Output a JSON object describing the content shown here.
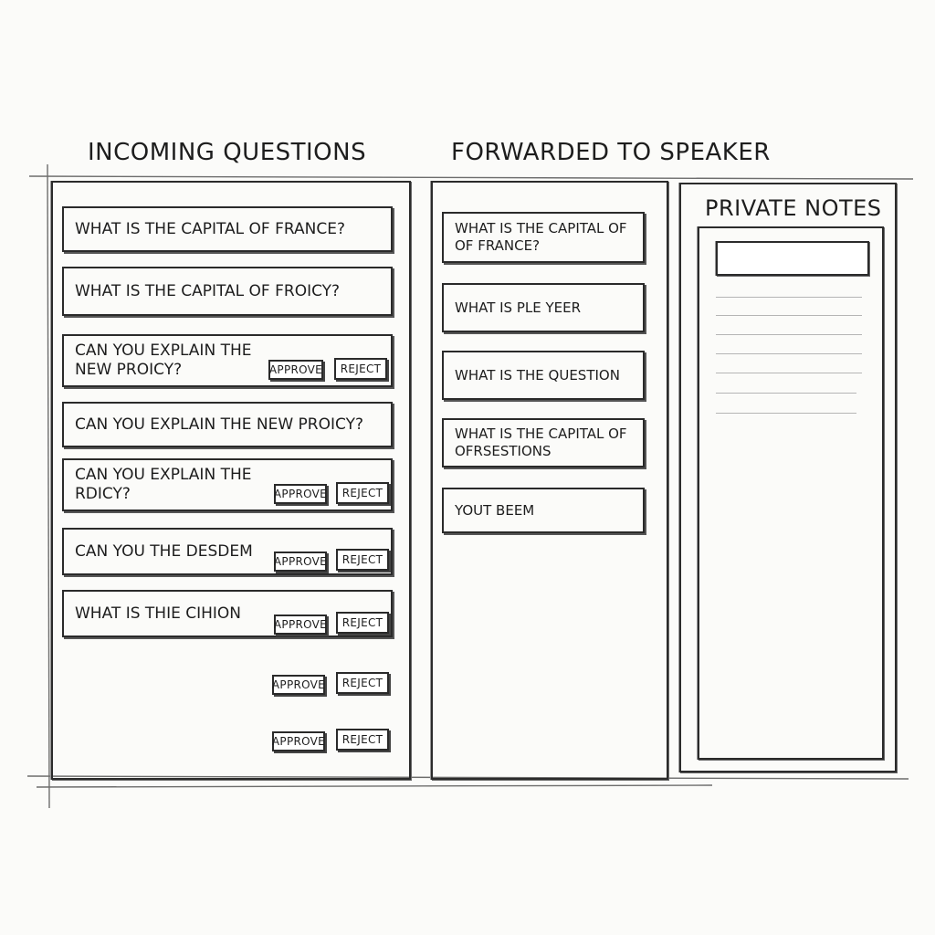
{
  "incoming": {
    "title": "Incoming Questions",
    "questions": [
      {
        "text": "What is the capital of France?"
      },
      {
        "text": "What is the capital of Froicy?"
      },
      {
        "text": "Can you explain the\nnew proicy?",
        "approve": "Approve",
        "reject": "Reject"
      },
      {
        "text": "Can you explain the new proicy?"
      },
      {
        "text": "Can you explain the\nrdicy?",
        "approve": "Approve",
        "reject": "Reject"
      },
      {
        "text": "Can you the desdem",
        "approve": "Approve",
        "reject": "Reject"
      },
      {
        "text": "What is thie cihion",
        "approve": "Approve",
        "reject": "Reject"
      }
    ],
    "extra_actions": [
      {
        "approve": "Approve",
        "reject": "Reject"
      },
      {
        "approve": "Approve",
        "reject": "Reject"
      }
    ]
  },
  "forwarded": {
    "title": "Forwarded to Speaker",
    "items": [
      {
        "text": "What is the capital of\nof France?"
      },
      {
        "text": "What is ple yeer"
      },
      {
        "text": "What is the question"
      },
      {
        "text": "What is the capital of\nofrsestions"
      },
      {
        "text": "Yout beem"
      }
    ]
  },
  "notes": {
    "title": "Private Notes",
    "input_value": ""
  }
}
